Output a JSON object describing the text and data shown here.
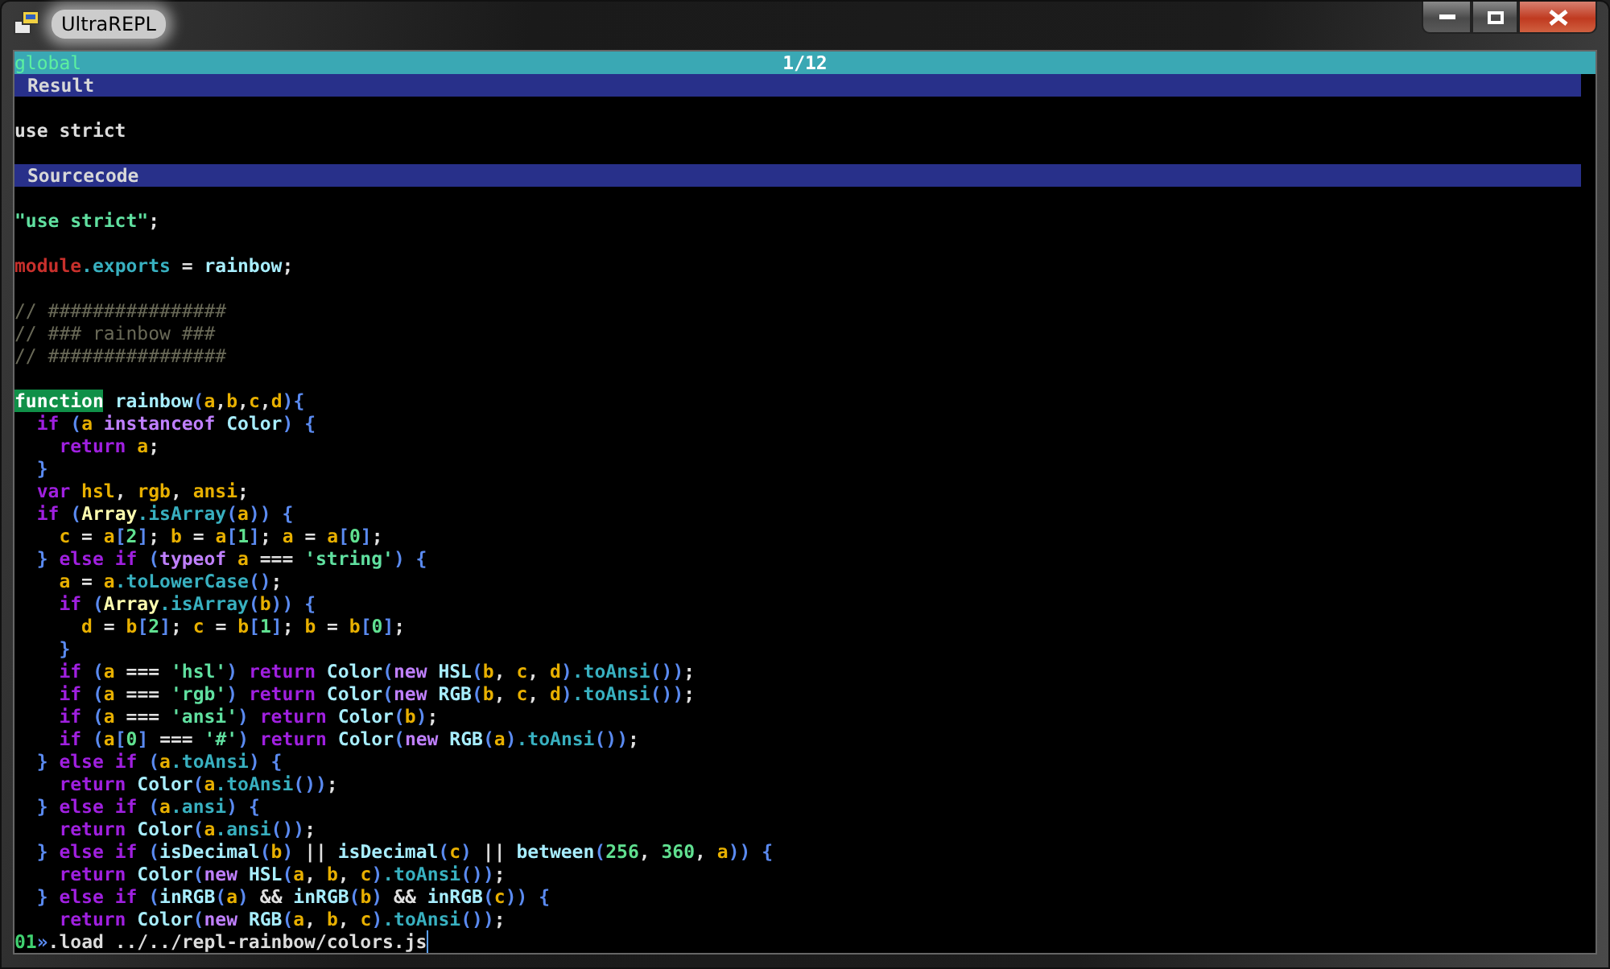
{
  "window": {
    "title": "UltraREPL"
  },
  "status_bar": {
    "context": "global",
    "position": "1/12"
  },
  "lines": [
    {
      "kind": "header",
      "text": "Result"
    },
    {
      "kind": "blank"
    },
    {
      "kind": "output",
      "text": "use strict"
    },
    {
      "kind": "blank"
    },
    {
      "kind": "header",
      "text": "Sourcecode"
    },
    {
      "kind": "blank"
    },
    {
      "kind": "code",
      "tokens": [
        {
          "text": "\"use strict\"",
          "kind": "string"
        },
        {
          "text": ";",
          "kind": "plain"
        }
      ]
    },
    {
      "kind": "blank"
    },
    {
      "kind": "code",
      "tokens": [
        {
          "text": "module",
          "kind": "global"
        },
        {
          "text": ".exports",
          "kind": "member"
        },
        {
          "text": " = ",
          "kind": "plain"
        },
        {
          "text": "rainbow",
          "kind": "function"
        },
        {
          "text": ";",
          "kind": "plain"
        }
      ]
    },
    {
      "kind": "blank"
    },
    {
      "kind": "code",
      "tokens": [
        {
          "text": "// ################",
          "kind": "comment"
        }
      ]
    },
    {
      "kind": "code",
      "tokens": [
        {
          "text": "// ### rainbow ###",
          "kind": "comment"
        }
      ]
    },
    {
      "kind": "code",
      "tokens": [
        {
          "text": "// ################",
          "kind": "comment"
        }
      ]
    },
    {
      "kind": "blank"
    },
    {
      "kind": "code",
      "tokens": [
        {
          "text": "function",
          "kind": "highlight"
        },
        {
          "text": " rainbow",
          "kind": "function"
        },
        {
          "text": "(",
          "kind": "bracket"
        },
        {
          "text": "a",
          "kind": "variable"
        },
        {
          "text": ",",
          "kind": "plain"
        },
        {
          "text": "b",
          "kind": "variable"
        },
        {
          "text": ",",
          "kind": "plain"
        },
        {
          "text": "c",
          "kind": "variable"
        },
        {
          "text": ",",
          "kind": "plain"
        },
        {
          "text": "d",
          "kind": "variable"
        },
        {
          "text": "){",
          "kind": "bracket"
        }
      ]
    },
    {
      "kind": "code",
      "tokens": [
        {
          "text": "  if ",
          "kind": "keyword"
        },
        {
          "text": "(",
          "kind": "bracket"
        },
        {
          "text": "a ",
          "kind": "variable"
        },
        {
          "text": "instanceof ",
          "kind": "operator"
        },
        {
          "text": "Color",
          "kind": "function"
        },
        {
          "text": ") {",
          "kind": "bracket"
        }
      ]
    },
    {
      "kind": "code",
      "tokens": [
        {
          "text": "    return ",
          "kind": "keyword"
        },
        {
          "text": "a",
          "kind": "variable"
        },
        {
          "text": ";",
          "kind": "plain"
        }
      ]
    },
    {
      "kind": "code",
      "tokens": [
        {
          "text": "  }",
          "kind": "bracket"
        }
      ]
    },
    {
      "kind": "code",
      "tokens": [
        {
          "text": "  var ",
          "kind": "keyword"
        },
        {
          "text": "hsl",
          "kind": "variable"
        },
        {
          "text": ", ",
          "kind": "plain"
        },
        {
          "text": "rgb",
          "kind": "variable"
        },
        {
          "text": ", ",
          "kind": "plain"
        },
        {
          "text": "ansi",
          "kind": "variable"
        },
        {
          "text": ";",
          "kind": "plain"
        }
      ]
    },
    {
      "kind": "code",
      "tokens": [
        {
          "text": "  if ",
          "kind": "keyword"
        },
        {
          "text": "(",
          "kind": "bracket"
        },
        {
          "text": "Array",
          "kind": "builtin"
        },
        {
          "text": ".isArray",
          "kind": "member"
        },
        {
          "text": "(",
          "kind": "bracket"
        },
        {
          "text": "a",
          "kind": "variable"
        },
        {
          "text": ")) {",
          "kind": "bracket"
        }
      ]
    },
    {
      "kind": "code",
      "tokens": [
        {
          "text": "    c",
          "kind": "variable"
        },
        {
          "text": " = ",
          "kind": "plain"
        },
        {
          "text": "a",
          "kind": "variable"
        },
        {
          "text": "[",
          "kind": "bracket"
        },
        {
          "text": "2",
          "kind": "number"
        },
        {
          "text": "]",
          "kind": "bracket"
        },
        {
          "text": "; ",
          "kind": "plain"
        },
        {
          "text": "b",
          "kind": "variable"
        },
        {
          "text": " = ",
          "kind": "plain"
        },
        {
          "text": "a",
          "kind": "variable"
        },
        {
          "text": "[",
          "kind": "bracket"
        },
        {
          "text": "1",
          "kind": "number"
        },
        {
          "text": "]",
          "kind": "bracket"
        },
        {
          "text": "; ",
          "kind": "plain"
        },
        {
          "text": "a",
          "kind": "variable"
        },
        {
          "text": " = ",
          "kind": "plain"
        },
        {
          "text": "a",
          "kind": "variable"
        },
        {
          "text": "[",
          "kind": "bracket"
        },
        {
          "text": "0",
          "kind": "number"
        },
        {
          "text": "]",
          "kind": "bracket"
        },
        {
          "text": ";",
          "kind": "plain"
        }
      ]
    },
    {
      "kind": "code",
      "tokens": [
        {
          "text": "  } ",
          "kind": "bracket"
        },
        {
          "text": "else if ",
          "kind": "keyword"
        },
        {
          "text": "(",
          "kind": "bracket"
        },
        {
          "text": "typeof ",
          "kind": "operator"
        },
        {
          "text": "a",
          "kind": "variable"
        },
        {
          "text": " === ",
          "kind": "plain"
        },
        {
          "text": "'string'",
          "kind": "string"
        },
        {
          "text": ") {",
          "kind": "bracket"
        }
      ]
    },
    {
      "kind": "code",
      "tokens": [
        {
          "text": "    a",
          "kind": "variable"
        },
        {
          "text": " = ",
          "kind": "plain"
        },
        {
          "text": "a",
          "kind": "variable"
        },
        {
          "text": ".toLowerCase",
          "kind": "member"
        },
        {
          "text": "()",
          "kind": "bracket"
        },
        {
          "text": ";",
          "kind": "plain"
        }
      ]
    },
    {
      "kind": "code",
      "tokens": [
        {
          "text": "    if ",
          "kind": "keyword"
        },
        {
          "text": "(",
          "kind": "bracket"
        },
        {
          "text": "Array",
          "kind": "builtin"
        },
        {
          "text": ".isArray",
          "kind": "member"
        },
        {
          "text": "(",
          "kind": "bracket"
        },
        {
          "text": "b",
          "kind": "variable"
        },
        {
          "text": ")) {",
          "kind": "bracket"
        }
      ]
    },
    {
      "kind": "code",
      "tokens": [
        {
          "text": "      d",
          "kind": "variable"
        },
        {
          "text": " = ",
          "kind": "plain"
        },
        {
          "text": "b",
          "kind": "variable"
        },
        {
          "text": "[",
          "kind": "bracket"
        },
        {
          "text": "2",
          "kind": "number"
        },
        {
          "text": "]",
          "kind": "bracket"
        },
        {
          "text": "; ",
          "kind": "plain"
        },
        {
          "text": "c",
          "kind": "variable"
        },
        {
          "text": " = ",
          "kind": "plain"
        },
        {
          "text": "b",
          "kind": "variable"
        },
        {
          "text": "[",
          "kind": "bracket"
        },
        {
          "text": "1",
          "kind": "number"
        },
        {
          "text": "]",
          "kind": "bracket"
        },
        {
          "text": "; ",
          "kind": "plain"
        },
        {
          "text": "b",
          "kind": "variable"
        },
        {
          "text": " = ",
          "kind": "plain"
        },
        {
          "text": "b",
          "kind": "variable"
        },
        {
          "text": "[",
          "kind": "bracket"
        },
        {
          "text": "0",
          "kind": "number"
        },
        {
          "text": "]",
          "kind": "bracket"
        },
        {
          "text": ";",
          "kind": "plain"
        }
      ]
    },
    {
      "kind": "code",
      "tokens": [
        {
          "text": "    }",
          "kind": "bracket"
        }
      ]
    },
    {
      "kind": "code",
      "tokens": [
        {
          "text": "    if ",
          "kind": "keyword"
        },
        {
          "text": "(",
          "kind": "bracket"
        },
        {
          "text": "a",
          "kind": "variable"
        },
        {
          "text": " === ",
          "kind": "plain"
        },
        {
          "text": "'hsl'",
          "kind": "string"
        },
        {
          "text": ") ",
          "kind": "bracket"
        },
        {
          "text": "return ",
          "kind": "keyword"
        },
        {
          "text": "Color",
          "kind": "function"
        },
        {
          "text": "(",
          "kind": "bracket"
        },
        {
          "text": "new ",
          "kind": "operator"
        },
        {
          "text": "HSL",
          "kind": "function"
        },
        {
          "text": "(",
          "kind": "bracket"
        },
        {
          "text": "b",
          "kind": "variable"
        },
        {
          "text": ", ",
          "kind": "plain"
        },
        {
          "text": "c",
          "kind": "variable"
        },
        {
          "text": ", ",
          "kind": "plain"
        },
        {
          "text": "d",
          "kind": "variable"
        },
        {
          "text": ")",
          "kind": "bracket"
        },
        {
          "text": ".toAnsi",
          "kind": "member"
        },
        {
          "text": "())",
          "kind": "bracket"
        },
        {
          "text": ";",
          "kind": "plain"
        }
      ]
    },
    {
      "kind": "code",
      "tokens": [
        {
          "text": "    if ",
          "kind": "keyword"
        },
        {
          "text": "(",
          "kind": "bracket"
        },
        {
          "text": "a",
          "kind": "variable"
        },
        {
          "text": " === ",
          "kind": "plain"
        },
        {
          "text": "'rgb'",
          "kind": "string"
        },
        {
          "text": ") ",
          "kind": "bracket"
        },
        {
          "text": "return ",
          "kind": "keyword"
        },
        {
          "text": "Color",
          "kind": "function"
        },
        {
          "text": "(",
          "kind": "bracket"
        },
        {
          "text": "new ",
          "kind": "operator"
        },
        {
          "text": "RGB",
          "kind": "function"
        },
        {
          "text": "(",
          "kind": "bracket"
        },
        {
          "text": "b",
          "kind": "variable"
        },
        {
          "text": ", ",
          "kind": "plain"
        },
        {
          "text": "c",
          "kind": "variable"
        },
        {
          "text": ", ",
          "kind": "plain"
        },
        {
          "text": "d",
          "kind": "variable"
        },
        {
          "text": ")",
          "kind": "bracket"
        },
        {
          "text": ".toAnsi",
          "kind": "member"
        },
        {
          "text": "())",
          "kind": "bracket"
        },
        {
          "text": ";",
          "kind": "plain"
        }
      ]
    },
    {
      "kind": "code",
      "tokens": [
        {
          "text": "    if ",
          "kind": "keyword"
        },
        {
          "text": "(",
          "kind": "bracket"
        },
        {
          "text": "a",
          "kind": "variable"
        },
        {
          "text": " === ",
          "kind": "plain"
        },
        {
          "text": "'ansi'",
          "kind": "string"
        },
        {
          "text": ") ",
          "kind": "bracket"
        },
        {
          "text": "return ",
          "kind": "keyword"
        },
        {
          "text": "Color",
          "kind": "function"
        },
        {
          "text": "(",
          "kind": "bracket"
        },
        {
          "text": "b",
          "kind": "variable"
        },
        {
          "text": ")",
          "kind": "bracket"
        },
        {
          "text": ";",
          "kind": "plain"
        }
      ]
    },
    {
      "kind": "code",
      "tokens": [
        {
          "text": "    if ",
          "kind": "keyword"
        },
        {
          "text": "(",
          "kind": "bracket"
        },
        {
          "text": "a",
          "kind": "variable"
        },
        {
          "text": "[",
          "kind": "bracket"
        },
        {
          "text": "0",
          "kind": "number"
        },
        {
          "text": "]",
          "kind": "bracket"
        },
        {
          "text": " === ",
          "kind": "plain"
        },
        {
          "text": "'#'",
          "kind": "string"
        },
        {
          "text": ") ",
          "kind": "bracket"
        },
        {
          "text": "return ",
          "kind": "keyword"
        },
        {
          "text": "Color",
          "kind": "function"
        },
        {
          "text": "(",
          "kind": "bracket"
        },
        {
          "text": "new ",
          "kind": "operator"
        },
        {
          "text": "RGB",
          "kind": "function"
        },
        {
          "text": "(",
          "kind": "bracket"
        },
        {
          "text": "a",
          "kind": "variable"
        },
        {
          "text": ")",
          "kind": "bracket"
        },
        {
          "text": ".toAnsi",
          "kind": "member"
        },
        {
          "text": "())",
          "kind": "bracket"
        },
        {
          "text": ";",
          "kind": "plain"
        }
      ]
    },
    {
      "kind": "code",
      "tokens": [
        {
          "text": "  } ",
          "kind": "bracket"
        },
        {
          "text": "else if ",
          "kind": "keyword"
        },
        {
          "text": "(",
          "kind": "bracket"
        },
        {
          "text": "a",
          "kind": "variable"
        },
        {
          "text": ".toAnsi",
          "kind": "member"
        },
        {
          "text": ") {",
          "kind": "bracket"
        }
      ]
    },
    {
      "kind": "code",
      "tokens": [
        {
          "text": "    return ",
          "kind": "keyword"
        },
        {
          "text": "Color",
          "kind": "function"
        },
        {
          "text": "(",
          "kind": "bracket"
        },
        {
          "text": "a",
          "kind": "variable"
        },
        {
          "text": ".toAnsi",
          "kind": "member"
        },
        {
          "text": "())",
          "kind": "bracket"
        },
        {
          "text": ";",
          "kind": "plain"
        }
      ]
    },
    {
      "kind": "code",
      "tokens": [
        {
          "text": "  } ",
          "kind": "bracket"
        },
        {
          "text": "else if ",
          "kind": "keyword"
        },
        {
          "text": "(",
          "kind": "bracket"
        },
        {
          "text": "a",
          "kind": "variable"
        },
        {
          "text": ".ansi",
          "kind": "member"
        },
        {
          "text": ") {",
          "kind": "bracket"
        }
      ]
    },
    {
      "kind": "code",
      "tokens": [
        {
          "text": "    return ",
          "kind": "keyword"
        },
        {
          "text": "Color",
          "kind": "function"
        },
        {
          "text": "(",
          "kind": "bracket"
        },
        {
          "text": "a",
          "kind": "variable"
        },
        {
          "text": ".ansi",
          "kind": "member"
        },
        {
          "text": "())",
          "kind": "bracket"
        },
        {
          "text": ";",
          "kind": "plain"
        }
      ]
    },
    {
      "kind": "code",
      "tokens": [
        {
          "text": "  } ",
          "kind": "bracket"
        },
        {
          "text": "else if ",
          "kind": "keyword"
        },
        {
          "text": "(",
          "kind": "bracket"
        },
        {
          "text": "isDecimal",
          "kind": "function"
        },
        {
          "text": "(",
          "kind": "bracket"
        },
        {
          "text": "b",
          "kind": "variable"
        },
        {
          "text": ")",
          "kind": "bracket"
        },
        {
          "text": " || ",
          "kind": "plain"
        },
        {
          "text": "isDecimal",
          "kind": "function"
        },
        {
          "text": "(",
          "kind": "bracket"
        },
        {
          "text": "c",
          "kind": "variable"
        },
        {
          "text": ")",
          "kind": "bracket"
        },
        {
          "text": " || ",
          "kind": "plain"
        },
        {
          "text": "between",
          "kind": "function"
        },
        {
          "text": "(",
          "kind": "bracket"
        },
        {
          "text": "256",
          "kind": "number"
        },
        {
          "text": ", ",
          "kind": "plain"
        },
        {
          "text": "360",
          "kind": "number"
        },
        {
          "text": ", ",
          "kind": "plain"
        },
        {
          "text": "a",
          "kind": "variable"
        },
        {
          "text": ")) {",
          "kind": "bracket"
        }
      ]
    },
    {
      "kind": "code",
      "tokens": [
        {
          "text": "    return ",
          "kind": "keyword"
        },
        {
          "text": "Color",
          "kind": "function"
        },
        {
          "text": "(",
          "kind": "bracket"
        },
        {
          "text": "new ",
          "kind": "operator"
        },
        {
          "text": "HSL",
          "kind": "function"
        },
        {
          "text": "(",
          "kind": "bracket"
        },
        {
          "text": "a",
          "kind": "variable"
        },
        {
          "text": ", ",
          "kind": "plain"
        },
        {
          "text": "b",
          "kind": "variable"
        },
        {
          "text": ", ",
          "kind": "plain"
        },
        {
          "text": "c",
          "kind": "variable"
        },
        {
          "text": ")",
          "kind": "bracket"
        },
        {
          "text": ".toAnsi",
          "kind": "member"
        },
        {
          "text": "())",
          "kind": "bracket"
        },
        {
          "text": ";",
          "kind": "plain"
        }
      ]
    },
    {
      "kind": "code",
      "tokens": [
        {
          "text": "  } ",
          "kind": "bracket"
        },
        {
          "text": "else if ",
          "kind": "keyword"
        },
        {
          "text": "(",
          "kind": "bracket"
        },
        {
          "text": "inRGB",
          "kind": "function"
        },
        {
          "text": "(",
          "kind": "bracket"
        },
        {
          "text": "a",
          "kind": "variable"
        },
        {
          "text": ")",
          "kind": "bracket"
        },
        {
          "text": " && ",
          "kind": "plain"
        },
        {
          "text": "inRGB",
          "kind": "function"
        },
        {
          "text": "(",
          "kind": "bracket"
        },
        {
          "text": "b",
          "kind": "variable"
        },
        {
          "text": ")",
          "kind": "bracket"
        },
        {
          "text": " && ",
          "kind": "plain"
        },
        {
          "text": "inRGB",
          "kind": "function"
        },
        {
          "text": "(",
          "kind": "bracket"
        },
        {
          "text": "c",
          "kind": "variable"
        },
        {
          "text": ")) {",
          "kind": "bracket"
        }
      ]
    },
    {
      "kind": "code",
      "tokens": [
        {
          "text": "    return ",
          "kind": "keyword"
        },
        {
          "text": "Color",
          "kind": "function"
        },
        {
          "text": "(",
          "kind": "bracket"
        },
        {
          "text": "new ",
          "kind": "operator"
        },
        {
          "text": "RGB",
          "kind": "function"
        },
        {
          "text": "(",
          "kind": "bracket"
        },
        {
          "text": "a",
          "kind": "variable"
        },
        {
          "text": ", ",
          "kind": "plain"
        },
        {
          "text": "b",
          "kind": "variable"
        },
        {
          "text": ", ",
          "kind": "plain"
        },
        {
          "text": "c",
          "kind": "variable"
        },
        {
          "text": ")",
          "kind": "bracket"
        },
        {
          "text": ".toAnsi",
          "kind": "member"
        },
        {
          "text": "())",
          "kind": "bracket"
        },
        {
          "text": ";",
          "kind": "plain"
        }
      ]
    }
  ],
  "prompt": {
    "number": "01",
    "marker": "»",
    "input": ".load ../../repl-rainbow/colors.js"
  }
}
